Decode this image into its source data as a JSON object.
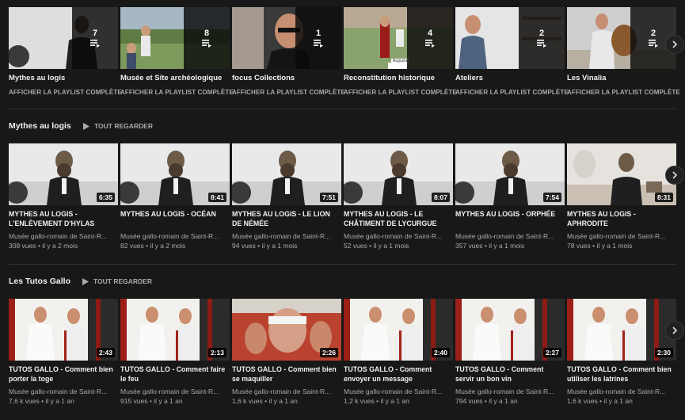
{
  "playlists": [
    {
      "title": "Mythes au logis",
      "count": "7",
      "link": "AFFICHER LA PLAYLIST COMPLÈTE",
      "thumb": "man-seated"
    },
    {
      "title": "Musée et Site archéologique",
      "count": "8",
      "link": "AFFICHER LA PLAYLIST COMPLÈTE",
      "thumb": "outdoor-group"
    },
    {
      "title": "focus Collections",
      "count": "1",
      "link": "AFFICHER LA PLAYLIST COMPLÈTE",
      "thumb": "glasses-man"
    },
    {
      "title": "Reconstitution historique",
      "count": "4",
      "link": "AFFICHER LA PLAYLIST COMPLÈTE",
      "thumb": "legionary",
      "badge": "Augusta"
    },
    {
      "title": "Ateliers",
      "count": "2",
      "link": "AFFICHER LA PLAYLIST COMPLÈTE",
      "thumb": "shelf-man"
    },
    {
      "title": "Les Vinalia",
      "count": "2",
      "link": "AFFICHER LA PLAYLIST COMPLÈTE",
      "thumb": "basket-man"
    }
  ],
  "shelves": [
    {
      "title": "Mythes au logis",
      "play_all": "TOUT REGARDER",
      "videos": [
        {
          "title": "MYTHES AU LOGIS - L'ENLÈVEMENT D'HYLAS",
          "duration": "6:35",
          "channel": "Musée gallo-romain de Saint-R...",
          "meta": "308 vues • il y a 2 mois",
          "thumb": "myth"
        },
        {
          "title": "MYTHES AU LOGIS - OCÉAN",
          "duration": "8:41",
          "channel": "Musée gallo-romain de Saint-R...",
          "meta": "82 vues • il y a 2 mois",
          "thumb": "myth"
        },
        {
          "title": "MYTHES AU LOGIS - LE LION DE NÉMÉE",
          "duration": "7:51",
          "channel": "Musée gallo-romain de Saint-R...",
          "meta": "94 vues • il y a 1 mois",
          "thumb": "myth"
        },
        {
          "title": "MYTHES AU LOGIS - LE CHÂTIMENT DE LYCURGUE",
          "duration": "8:07",
          "channel": "Musée gallo-romain de Saint-R...",
          "meta": "52 vues • il y a 1 mois",
          "thumb": "myth"
        },
        {
          "title": "MYTHES AU LOGIS - ORPHÉE",
          "duration": "7:54",
          "channel": "Musée gallo-romain de Saint-R...",
          "meta": "357 vues • il y a 1 mois",
          "thumb": "myth"
        },
        {
          "title": "MYTHES AU LOGIS - APHRODITE",
          "duration": "8:31",
          "channel": "Musée gallo-romain de Saint-R...",
          "meta": "78 vues • il y a 1 mois",
          "thumb": "myth-bust"
        }
      ]
    },
    {
      "title": "Les Tutos Gallo",
      "play_all": "TOUT REGARDER",
      "videos": [
        {
          "title": "TUTOS GALLO - Comment bien porter la toge",
          "duration": "2:43",
          "channel": "Musée gallo-romain de Saint-R...",
          "meta": "7,6 k vues • il y a 1 an",
          "thumb": "toga"
        },
        {
          "title": "TUTOS GALLO - Comment faire le feu",
          "duration": "2:13",
          "channel": "Musée gallo-romain de Saint-R...",
          "meta": "915 vues • il y a 1 an",
          "thumb": "toga"
        },
        {
          "title": "TUTOS GALLO - Comment bien se maquiller",
          "duration": "2:26",
          "channel": "Musée gallo-romain de Saint-R...",
          "meta": "1,6 k vues • il y a 1 an",
          "thumb": "makeup"
        },
        {
          "title": "TUTOS GALLO - Comment envoyer un message",
          "duration": "2:40",
          "channel": "Musée gallo-romain de Saint-R...",
          "meta": "1,2 k vues • il y a 1 an",
          "thumb": "toga"
        },
        {
          "title": "TUTOS GALLO - Comment servir un bon vin",
          "duration": "2:27",
          "channel": "Musée gallo-romain de Saint-R...",
          "meta": "794 vues • il y a 1 an",
          "thumb": "toga"
        },
        {
          "title": "TUTOS GALLO - Comment bien utiliser les latrines",
          "duration": "2:30",
          "channel": "Musée gallo-romain de Saint-R...",
          "meta": "1,6 k vues • il y a 1 an",
          "thumb": "toga"
        }
      ]
    }
  ],
  "colors": {
    "background": "#181818",
    "text": "#f1f1f1",
    "muted": "#aaaaaa",
    "divider": "#303030"
  },
  "icons": {
    "playlist": "playlist-icon",
    "play": "play-icon",
    "next": "chevron-right-icon"
  }
}
